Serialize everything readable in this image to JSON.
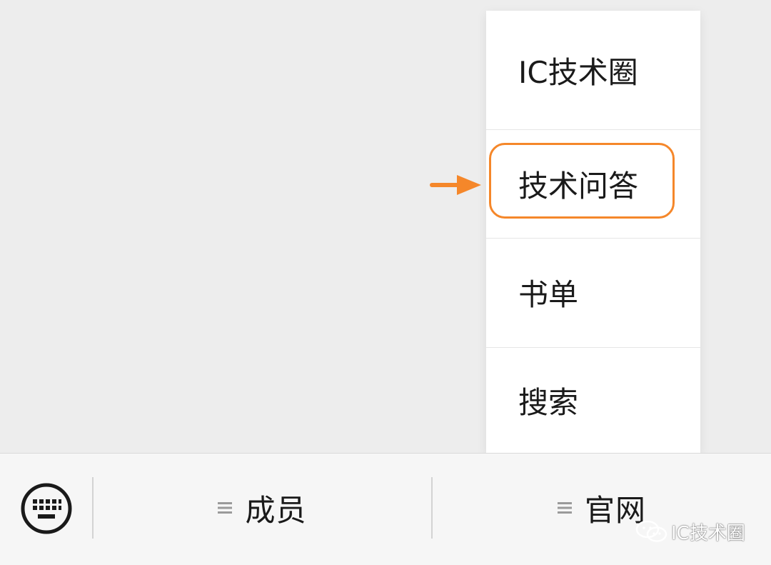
{
  "menu": {
    "items": [
      {
        "label": "IC技术圈"
      },
      {
        "label": "技术问答"
      },
      {
        "label": "书单"
      },
      {
        "label": "搜索"
      }
    ],
    "highlighted_index": 1
  },
  "bottom_bar": {
    "keyboard_icon": "keyboard-icon",
    "tabs": [
      {
        "label": "成员",
        "icon": "menu-lines-icon"
      },
      {
        "label": "官网",
        "icon": "menu-lines-icon"
      }
    ]
  },
  "watermark": {
    "text": "IC技术圈",
    "icon": "wechat-icon"
  },
  "colors": {
    "accent": "#f5872a",
    "background": "#ededed",
    "menu_bg": "#ffffff",
    "bar_bg": "#f6f6f6",
    "text": "#1a1a1a"
  }
}
